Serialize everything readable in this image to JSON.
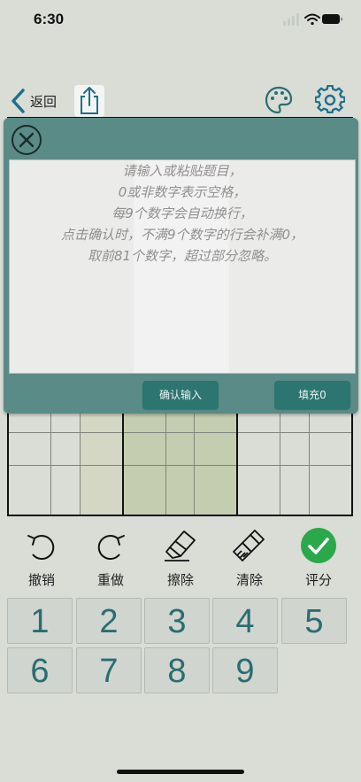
{
  "status_bar": {
    "time": "6:30"
  },
  "nav": {
    "back_label": "返回"
  },
  "input_panel": {
    "placeholder_lines": [
      "请输入或粘贴题目，",
      "0或非数字表示空格，",
      "每9个数字会自动换行，",
      "点击确认时，不满9个数字的行会补满0，",
      "取前81个数字，超过部分忽略。"
    ],
    "confirm_label": "确认输入",
    "fill_label": "填充0"
  },
  "toolbar": {
    "undo_label": "撤销",
    "redo_label": "重做",
    "erase_label": "擦除",
    "clear_label": "清除",
    "score_label": "评分"
  },
  "keypad": {
    "keys": [
      "1",
      "2",
      "3",
      "4",
      "5",
      "6",
      "7",
      "8",
      "9"
    ]
  },
  "colors": {
    "panel": "#5a8b87",
    "button": "#2d7571",
    "digit": "#2a6d72",
    "score_green": "#2aa84a",
    "accent_icon": "#1f6f8b"
  }
}
